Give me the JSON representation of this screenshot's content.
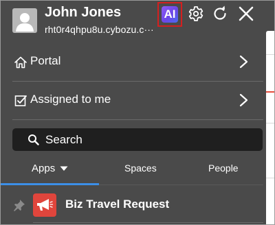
{
  "user": {
    "name": "John Jones",
    "domain": "rht0r4qhpu8u.cybozu.c···"
  },
  "header": {
    "ai_label": "AI",
    "icons": [
      "user-avatar-icon",
      "gear-icon",
      "refresh-icon",
      "close-icon"
    ]
  },
  "nav": {
    "portal_label": "Portal",
    "assigned_label": "Assigned to me"
  },
  "search": {
    "label": "Search"
  },
  "tabs": {
    "apps": "Apps",
    "spaces": "Spaces",
    "people": "People",
    "active": "Apps"
  },
  "apps": [
    {
      "label": "Biz Travel Request",
      "icon": "megaphone-icon"
    }
  ],
  "colors": {
    "panel_bg": "#4a4a4a",
    "search_bg": "#1f1f1f",
    "active_tab": "#3c8fe8",
    "ai_highlight_border": "#d42020",
    "app_icon_bg": "#e0453c"
  }
}
